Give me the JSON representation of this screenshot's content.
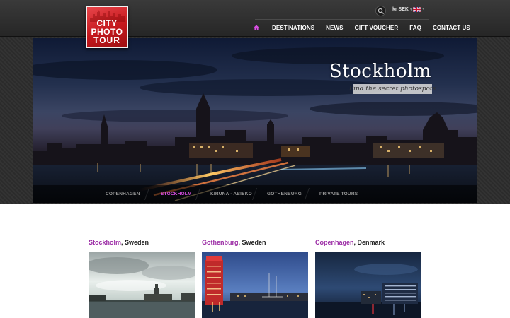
{
  "logo": {
    "line1": "CITY",
    "line2": "PHOTO",
    "line3": "TOUR"
  },
  "topbar": {
    "currency": "kr SEK",
    "caret": "▾"
  },
  "nav": {
    "items": [
      "DESTINATIONS",
      "NEWS",
      "GIFT VOUCHER",
      "FAQ",
      "CONTACT US"
    ]
  },
  "hero": {
    "title": "Stockholm",
    "tagline": "Find the secret photospots",
    "tabs": [
      "COPENHAGEN",
      "STOCKHOLM",
      "KIRUNA - ABISKO",
      "GOTHENBURG",
      "PRIVATE TOURS"
    ],
    "active_tab": "STOCKHOLM"
  },
  "cities": [
    {
      "name": "Stockholm",
      "country": ", Sweden"
    },
    {
      "name": "Gothenburg",
      "country": ", Sweden"
    },
    {
      "name": "Copenhagen",
      "country": ", Denmark"
    }
  ],
  "colors": {
    "accent": "#d94fe3",
    "city_name": "#9b2ba5",
    "logo_red": "#c5181d"
  },
  "icons": {
    "home": "home-icon",
    "search": "search-icon",
    "flag": "uk-flag-icon"
  }
}
